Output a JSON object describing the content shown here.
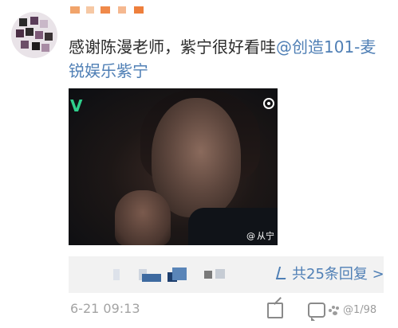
{
  "post": {
    "text_main": "感谢陈漫老师，紫宁很好看哇",
    "mention_part1": "@创造101-麦",
    "mention_part2": "锐娱乐紫宁",
    "timestamp": "6-21 09:13"
  },
  "video": {
    "logo_letter": "V",
    "watermark_prefix": "@",
    "watermark_text": "从宁"
  },
  "replies": {
    "link_text": "共25条回复 >"
  },
  "footer": {
    "source_text": "@1/98"
  },
  "colors": {
    "link_blue": "#4f7fb5",
    "text_dark": "#2b2b2b",
    "time_gray": "#a3a3a3",
    "reply_bg": "#f2f2f2"
  }
}
